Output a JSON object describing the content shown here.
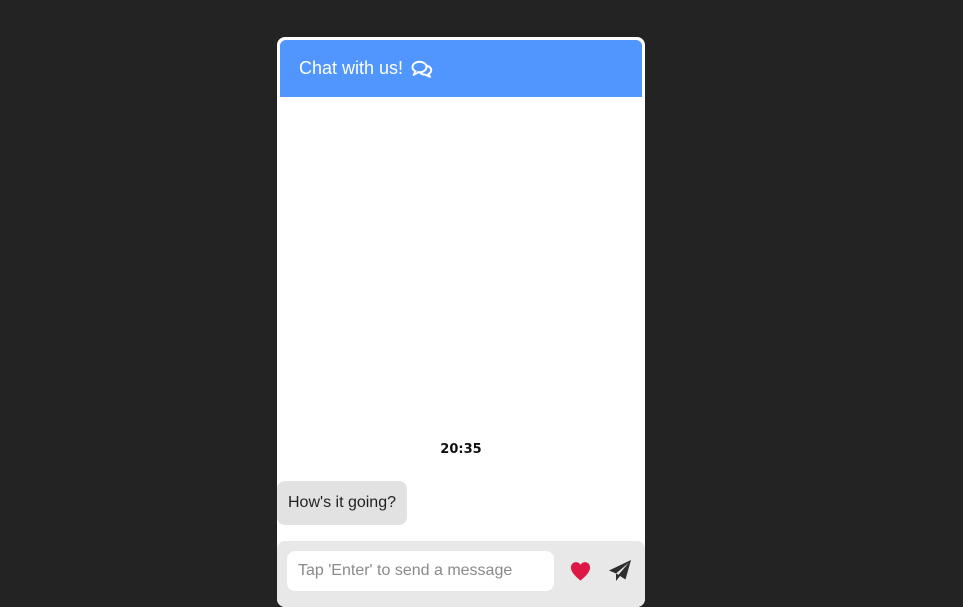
{
  "header": {
    "title": "Chat with us!",
    "icon": "comments-icon",
    "background_color": "#5096fe"
  },
  "conversation": {
    "timestamp": "20:35",
    "messages": [
      {
        "text": "How's it going?"
      }
    ]
  },
  "composer": {
    "value": "",
    "placeholder": "Tap 'Enter' to send a message",
    "like_icon": "heart-icon",
    "like_color": "#dc1945",
    "send_icon": "paper-plane-icon"
  },
  "colors": {
    "page_background": "#232323",
    "bubble_background": "#e2e2e2"
  }
}
